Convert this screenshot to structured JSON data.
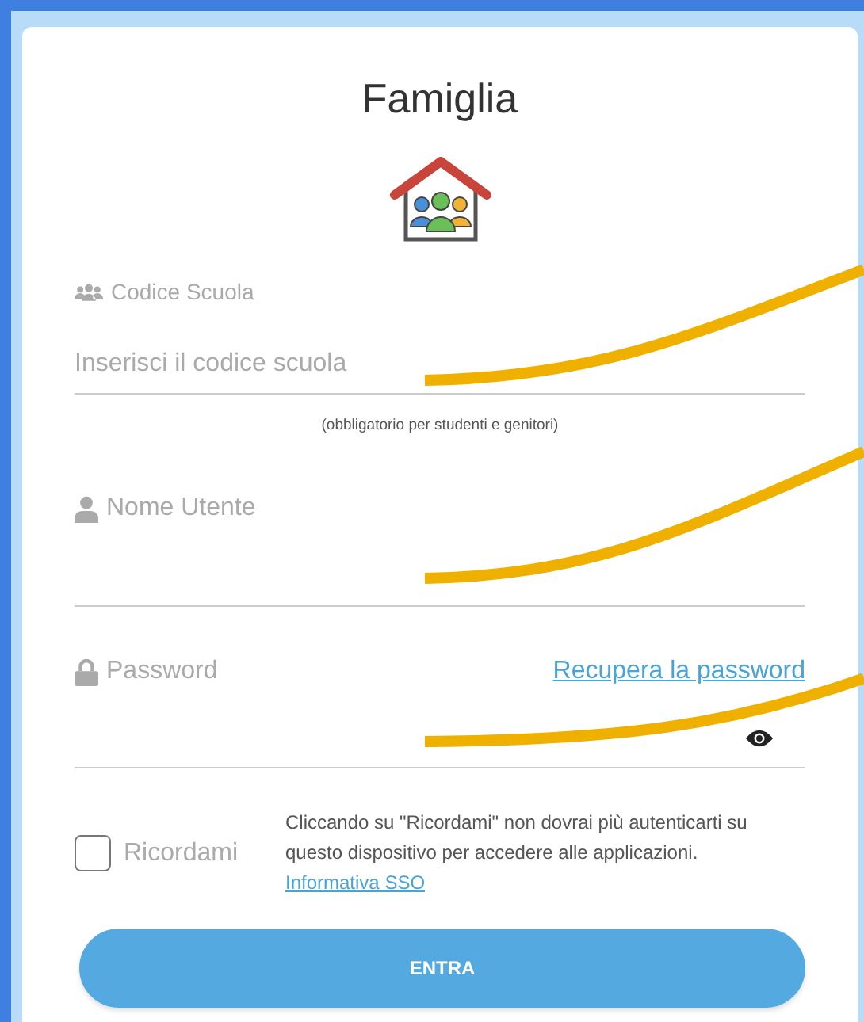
{
  "title": "Famiglia",
  "school_field": {
    "label": "Codice Scuola",
    "placeholder": "Inserisci il codice scuola",
    "note": "(obbligatorio per studenti e genitori)"
  },
  "username_field": {
    "label": "Nome Utente"
  },
  "password_field": {
    "label": "Password",
    "link": "Recupera la password"
  },
  "remember": {
    "label": "Ricordami",
    "checked": false,
    "text": "Cliccando su \"Ricordami\" non dovrai più autenticarti su questo dispositivo per accedere alle applicazioni.",
    "link": "Informativa SSO"
  },
  "submit": "ENTRA"
}
